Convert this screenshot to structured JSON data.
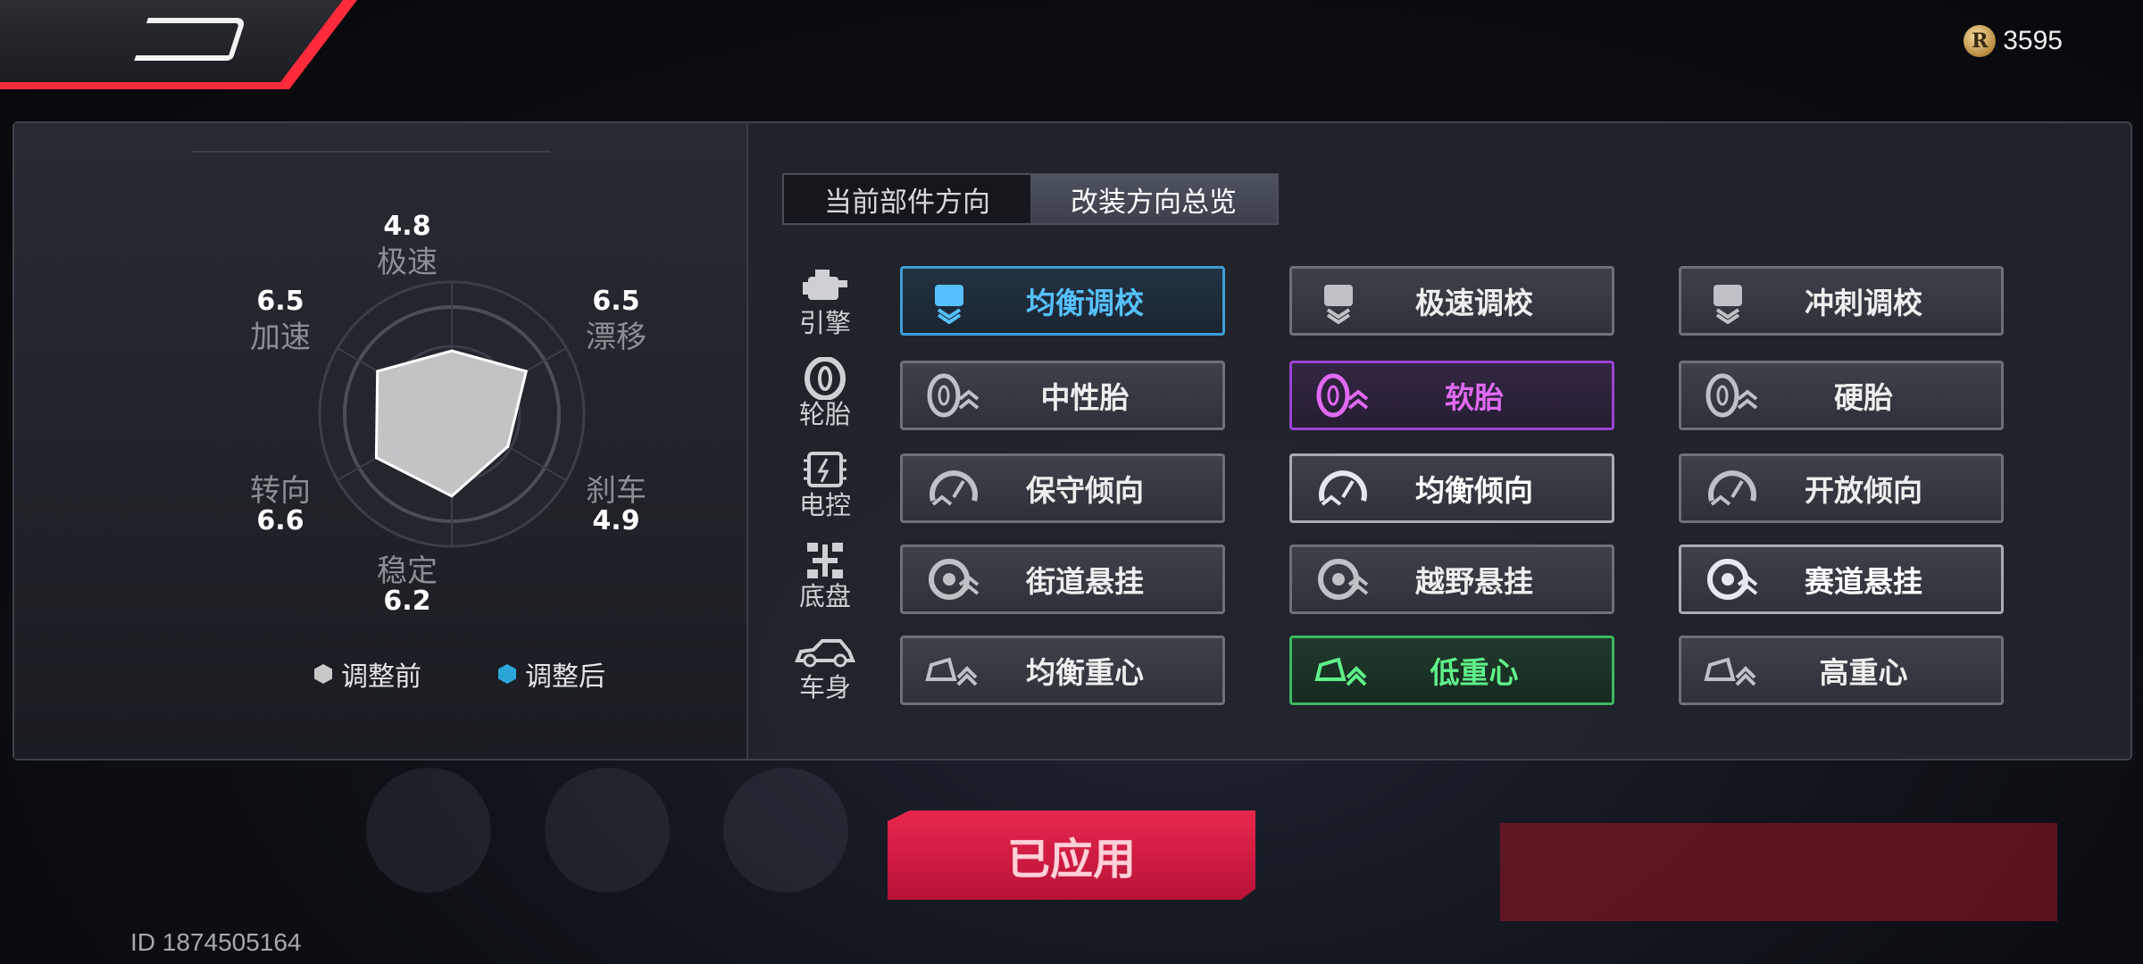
{
  "header": {
    "currency_value": "3595",
    "currency_symbol": "R"
  },
  "stats": {
    "top_speed": {
      "label": "极速",
      "value": "4.8"
    },
    "acceleration": {
      "label": "加速",
      "value": "6.5"
    },
    "drift": {
      "label": "漂移",
      "value": "6.5"
    },
    "steering": {
      "label": "转向",
      "value": "6.6"
    },
    "braking": {
      "label": "刹车",
      "value": "4.9"
    },
    "stability": {
      "label": "稳定",
      "value": "6.2"
    }
  },
  "legend": {
    "before": "调整前",
    "after": "调整后",
    "before_color": "#c8c8c8",
    "after_color": "#2aa6d8"
  },
  "tabs": [
    {
      "label": "当前部件方向",
      "active": false
    },
    {
      "label": "改装方向总览",
      "active": true
    }
  ],
  "categories": [
    {
      "label": "引擎",
      "icon": "engine-icon"
    },
    {
      "label": "轮胎",
      "icon": "tire-icon"
    },
    {
      "label": "电控",
      "icon": "chip-icon"
    },
    {
      "label": "底盘",
      "icon": "chassis-icon"
    },
    {
      "label": "车身",
      "icon": "car-body-icon"
    }
  ],
  "options": [
    [
      {
        "label": "均衡调校",
        "state": "blue"
      },
      {
        "label": "极速调校",
        "state": "normal"
      },
      {
        "label": "冲刺调校",
        "state": "normal"
      }
    ],
    [
      {
        "label": "中性胎",
        "state": "normal"
      },
      {
        "label": "软胎",
        "state": "purple"
      },
      {
        "label": "硬胎",
        "state": "normal"
      }
    ],
    [
      {
        "label": "保守倾向",
        "state": "normal"
      },
      {
        "label": "均衡倾向",
        "state": "bright"
      },
      {
        "label": "开放倾向",
        "state": "normal"
      }
    ],
    [
      {
        "label": "街道悬挂",
        "state": "normal"
      },
      {
        "label": "越野悬挂",
        "state": "normal"
      },
      {
        "label": "赛道悬挂",
        "state": "bright"
      }
    ],
    [
      {
        "label": "均衡重心",
        "state": "normal"
      },
      {
        "label": "低重心",
        "state": "green"
      },
      {
        "label": "高重心",
        "state": "normal"
      }
    ]
  ],
  "apply_button": "已应用",
  "user_id": "ID 1874505164",
  "colors": {
    "accent_red": "#ff2a3c",
    "blue": "#56c0ff",
    "purple": "#e06af2",
    "green": "#5ff08a"
  }
}
